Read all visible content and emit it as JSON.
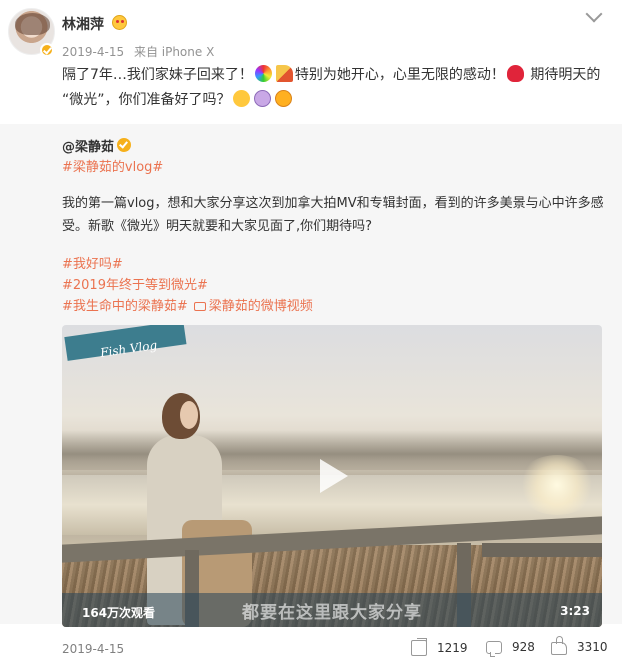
{
  "post": {
    "author": "林湘萍",
    "date": "2019-4-15",
    "source": "来自 iPhone X",
    "text_a": "隔了7年…我们家妹子回来了！",
    "text_b": "特别为她开心，心里无限的感动！",
    "text_c": "期待明天的",
    "text_d": "“微光”，你们准备好了吗？"
  },
  "repost": {
    "author": "@梁静茹",
    "tag_main": "#梁静茹的vlog#",
    "body": "我的第一篇vlog，想和大家分享这次到加拿大拍MV和专辑封面，看到的许多美景与心中许多感受。新歌《微光》明天就要和大家见面了,你们期待吗?",
    "tags": [
      "#我好吗#",
      "#2019年终于等到微光#",
      "#我生命中的梁静茹#"
    ],
    "video_link": "梁静茹的微博视频"
  },
  "video": {
    "banner_text": "Fish Vlog",
    "views": "164万次观看",
    "subtitle": "都要在这里跟大家分享",
    "duration": "3:23"
  },
  "footer": {
    "date": "2019-4-15",
    "reposts": "1219",
    "comments": "928",
    "likes": "3310"
  },
  "icons": [
    "verified-icon",
    "chevron-down-icon",
    "rainbow-emoji-icon",
    "party-emoji-icon",
    "heart-emoji-icon",
    "hug-emoji-icon",
    "ghost-emoji-icon",
    "star-eyes-emoji-icon",
    "video-icon",
    "play-icon",
    "share-icon",
    "comment-icon",
    "like-icon"
  ],
  "colors": {
    "tag": "#eb7350",
    "verified": "#f6b01b",
    "meta": "#939393"
  }
}
